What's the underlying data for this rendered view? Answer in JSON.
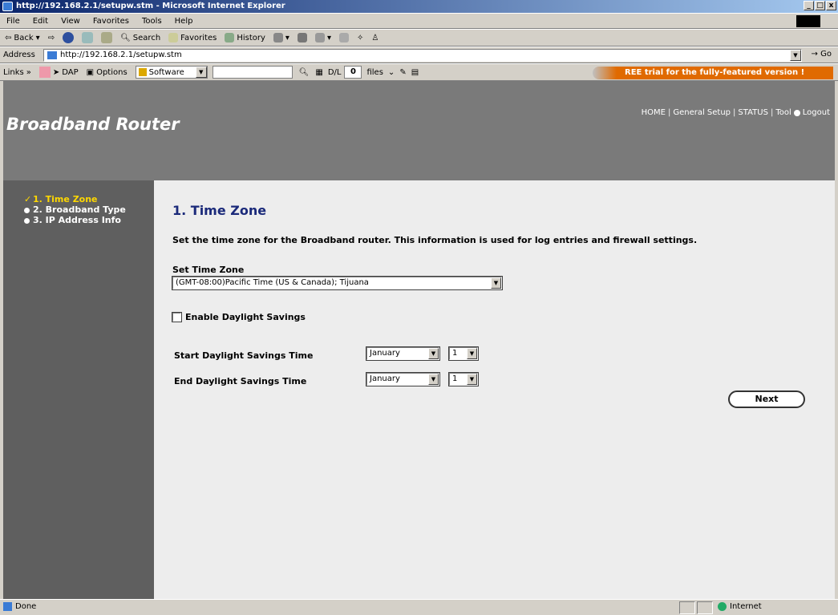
{
  "window": {
    "title": "http://192.168.2.1/setupw.stm - Microsoft Internet Explorer",
    "btn_min": "_",
    "btn_max": "□",
    "btn_close": "x"
  },
  "menu": [
    "File",
    "Edit",
    "View",
    "Favorites",
    "Tools",
    "Help"
  ],
  "toolbar": {
    "back": "Back",
    "search": "Search",
    "favorites": "Favorites",
    "history": "History"
  },
  "address": {
    "label": "Address",
    "url": "http://192.168.2.1/setupw.stm",
    "go": "Go"
  },
  "links": {
    "label": "Links",
    "dap": "DAP",
    "options": "Options",
    "software": "Software",
    "dl": "D/L",
    "dl_count": "0",
    "files": "files",
    "promo": "REE trial for the fully-featured version !"
  },
  "header": {
    "brand": "Broadband Router",
    "nav": [
      "HOME",
      "General Setup",
      "STATUS",
      "Tool",
      "Logout"
    ]
  },
  "sidebar": {
    "items": [
      {
        "label": "1. Time Zone",
        "state": "checked"
      },
      {
        "label": "2. Broadband Type",
        "state": "bullet"
      },
      {
        "label": "3. IP Address Info",
        "state": "bullet"
      }
    ]
  },
  "main": {
    "title": "1. Time Zone",
    "description": "Set the time zone for the Broadband router. This information is used for log entries and firewall settings.",
    "tz_label": "Set Time Zone",
    "tz_value": "(GMT-08:00)Pacific Time (US & Canada); Tijuana",
    "dst_checkbox_label": "Enable Daylight Savings",
    "dst_checked": false,
    "start_label": "Start Daylight Savings Time",
    "start_month": "January",
    "start_day": "1",
    "end_label": "End Daylight Savings Time",
    "end_month": "January",
    "end_day": "1",
    "next_button": "Next"
  },
  "status": {
    "left": "Done",
    "zone": "Internet"
  }
}
